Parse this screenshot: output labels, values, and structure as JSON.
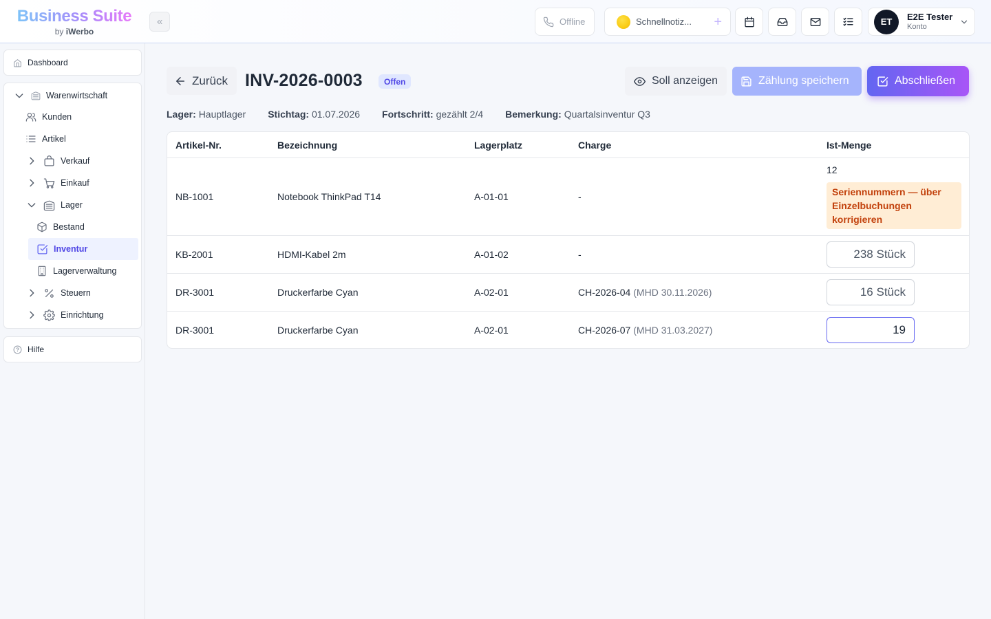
{
  "brand": {
    "title": "Business Suite",
    "by": "by",
    "company": "iWerbo"
  },
  "topbar": {
    "status": "Offline",
    "note_placeholder": "Schnellnotiz...",
    "note_add": "+",
    "user": {
      "initials": "ET",
      "name": "E2E Tester",
      "role": "Konto"
    }
  },
  "sidebar": {
    "dashboard": "Dashboard",
    "help": "Hilfe",
    "group": "Warenwirtschaft",
    "items": {
      "kunden": "Kunden",
      "artikel": "Artikel",
      "verkauf": "Verkauf",
      "einkauf": "Einkauf",
      "lager": "Lager",
      "bestand": "Bestand",
      "inventur": "Inventur",
      "lagerverwaltung": "Lagerverwaltung",
      "steuern": "Steuern",
      "einrichtung": "Einrichtung"
    }
  },
  "header": {
    "back": "Zurück",
    "title": "INV-2026-0003",
    "status": "Offen",
    "actions": {
      "soll": "Soll anzeigen",
      "save": "Zählung speichern",
      "close": "Abschließen"
    }
  },
  "meta": {
    "lager_label": "Lager:",
    "lager": "Hauptlager",
    "stichtag_label": "Stichtag:",
    "stichtag": "01.07.2026",
    "fortschritt_label": "Fortschritt:",
    "fortschritt": "gezählt 2/4",
    "bemerkung_label": "Bemerkung:",
    "bemerkung": "Quartalsinventur Q3"
  },
  "table": {
    "columns": [
      "Artikel-Nr.",
      "Bezeichnung",
      "Lagerplatz",
      "Charge",
      "Ist-Menge"
    ],
    "rows": [
      {
        "nr": "NB-1001",
        "name": "Notebook ThinkPad T14",
        "platz": "A-01-01",
        "charge": "-",
        "charge_note": "",
        "qty": "12",
        "warning": "Seriennummern — über Einzelbuchungen korrigieren"
      },
      {
        "nr": "KB-2001",
        "name": "HDMI-Kabel 2m",
        "platz": "A-01-02",
        "charge": "-",
        "charge_note": "",
        "qty": "238 Stück"
      },
      {
        "nr": "DR-3001",
        "name": "Druckerfarbe Cyan",
        "platz": "A-02-01",
        "charge": "CH-2026-04",
        "charge_note": "(MHD 30.11.2026)",
        "qty": "16 Stück"
      },
      {
        "nr": "DR-3001",
        "name": "Druckerfarbe Cyan",
        "platz": "A-02-01",
        "charge": "CH-2026-07",
        "charge_note": "(MHD 31.03.2027)",
        "qty": "19"
      }
    ]
  },
  "colors": {
    "accent": "#6366f1",
    "accent2": "#a855f7",
    "warning_bg": "#ffedd5",
    "warning_text": "#c2410c"
  }
}
